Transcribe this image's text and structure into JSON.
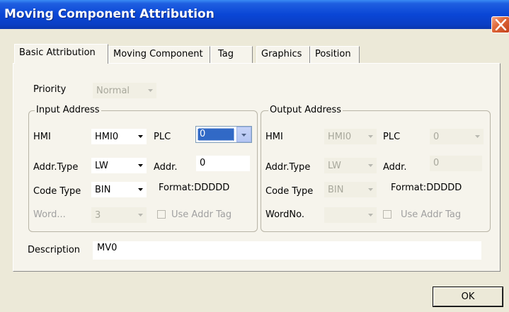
{
  "window": {
    "title": "Moving Component Attribution",
    "close_icon": "close-icon",
    "ok_label": "OK"
  },
  "tabs": [
    {
      "label": "Basic Attribution",
      "active": true
    },
    {
      "label": "Moving Component",
      "active": false
    },
    {
      "label": "Tag",
      "active": false
    },
    {
      "label": "Graphics",
      "active": false
    },
    {
      "label": "Position",
      "active": false
    }
  ],
  "priority": {
    "label": "Priority",
    "value": "Normal"
  },
  "input": {
    "legend": "Input Address",
    "hmi_label": "HMI",
    "hmi_value": "HMI0",
    "plc_label": "PLC",
    "plc_value": "0",
    "addr_type_label": "Addr.Type",
    "addr_type_value": "LW",
    "addr_label": "Addr.",
    "addr_value": "0",
    "code_type_label": "Code Type",
    "code_type_value": "BIN",
    "format": "Format:DDDDD",
    "word_label": "Word...",
    "word_value": "3",
    "use_addr_tag_label": "Use Addr Tag"
  },
  "output": {
    "legend": "Output Address",
    "hmi_label": "HMI",
    "hmi_value": "HMI0",
    "plc_label": "PLC",
    "plc_value": "0",
    "addr_type_label": "Addr.Type",
    "addr_type_value": "LW",
    "addr_label": "Addr.",
    "addr_value": "0",
    "code_type_label": "Code Type",
    "code_type_value": "BIN",
    "format": "Format:DDDDD",
    "word_label": "WordNo.",
    "word_value": "",
    "use_addr_tag_label": "Use Addr Tag"
  },
  "description": {
    "label": "Description",
    "value": "MV0"
  },
  "colors": {
    "title_bar": "#0a46d6",
    "selection": "#3169c6",
    "close_button": "#e06a3c"
  }
}
